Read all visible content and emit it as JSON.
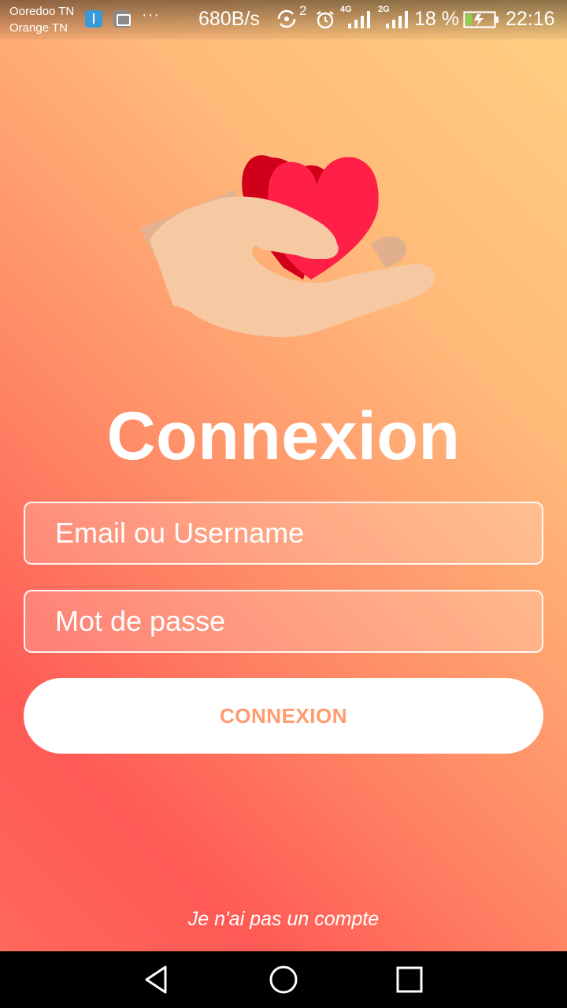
{
  "status_bar": {
    "carrier1": "Ooredoo TN",
    "carrier2": "Orange TN",
    "more": "···",
    "net_speed": "680B/s",
    "sync_count": "2",
    "network1": "4G",
    "network2": "2G",
    "battery": "18 %",
    "time": "22:16"
  },
  "header": {
    "illustration_icon": "hand-holding-heart",
    "title": "Connexion"
  },
  "form": {
    "email_placeholder": "Email ou Username",
    "password_placeholder": "Mot de passe",
    "submit_label": "CONNEXION"
  },
  "footer": {
    "signup_link": "Je n'ai pas un compte"
  },
  "nav": {
    "back_icon": "triangle-back-icon",
    "home_icon": "circle-home-icon",
    "recent_icon": "square-recent-icon"
  },
  "colors": {
    "accent": "#ff9b6e",
    "heart": "#ff1f47",
    "gradient_top": "#ffd083",
    "gradient_bottom": "#ff5a55"
  }
}
